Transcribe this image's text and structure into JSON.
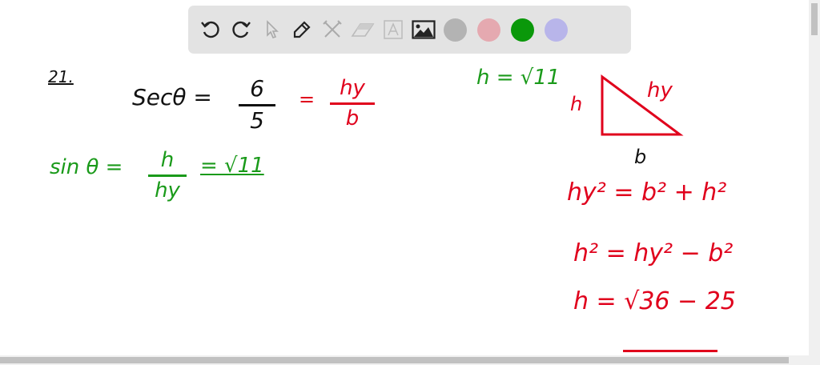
{
  "toolbar": {
    "tools": [
      "undo-icon",
      "redo-icon",
      "pointer-icon",
      "pen-icon",
      "tools-icon",
      "eraser-icon",
      "text-icon",
      "image-icon"
    ],
    "colors": [
      "#b3b3b3",
      "#e5a9b0",
      "#0a980a",
      "#b8b5ea"
    ]
  },
  "work": {
    "problem_number": "21.",
    "sec_lhs": "Secθ =",
    "sec_num": "6",
    "sec_den": "5",
    "eq": "=",
    "hy": "hy",
    "b": "b",
    "sin_lhs": "sin θ =",
    "sin_num": "h",
    "sin_den": "hy",
    "sin_result": "= √11",
    "h_value": "h = √11",
    "tri_h": "h",
    "tri_hy": "hy",
    "tri_b": "b",
    "line1": "hy² = b² + h²",
    "line2": "h² = hy² − b²",
    "line3": "h = √36 − 25"
  },
  "colors": {
    "black": "#111111",
    "red": "#e0001c",
    "green": "#1a9a1a"
  }
}
